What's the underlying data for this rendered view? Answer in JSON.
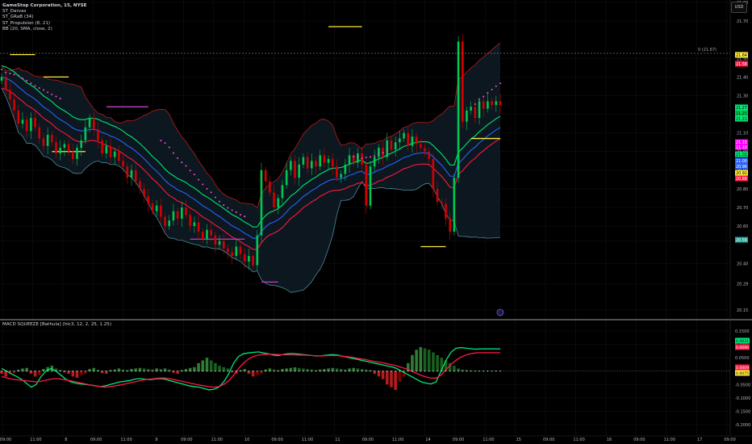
{
  "header": {
    "symbol": "GameStop Corporation, 15, NYSE",
    "indicators": [
      "ST_Darvas",
      "ST_GRaB (34)",
      "ST_Propulsion (8, 21)",
      "BB (20, SMA, close, 2)"
    ]
  },
  "currency_label": "USD",
  "lower_indicator_title": "MACD SQUEEZE [Bathula] (hlc3, 12, 2, 25, 1.25)",
  "price_axis": {
    "ticks": [
      "21.80",
      "21.70",
      "21.50",
      "21.40",
      "21.30",
      "21.20",
      "21.10",
      "21.00",
      "20.90",
      "20.80",
      "20.70",
      "20.60",
      "20.52",
      "20.40",
      "20.29",
      "20.15"
    ]
  },
  "price_level_label": "0 (21.67)",
  "price_badges": [
    {
      "text": "21.64",
      "color": "#ffeb3b",
      "textColor": "#000"
    },
    {
      "text": "21.58",
      "color": "#ff1744",
      "textColor": "#fff"
    },
    {
      "text": "21.27",
      "color": "#00e676",
      "textColor": "#000"
    },
    {
      "text": "21.25",
      "color": "#00c853",
      "textColor": "#000"
    },
    {
      "text": "21.21",
      "color": "#00e676",
      "textColor": "#000"
    },
    {
      "text": "21.15",
      "color": "#ff00ff",
      "textColor": "#fff"
    },
    {
      "text": "21.10",
      "color": "#ff00ff",
      "textColor": "#fff"
    },
    {
      "text": "21.02",
      "color": "#00e676",
      "textColor": "#000"
    },
    {
      "text": "21.00",
      "color": "#2962ff",
      "textColor": "#fff"
    },
    {
      "text": "20.96",
      "color": "#2962ff",
      "textColor": "#fff"
    },
    {
      "text": "20.92",
      "color": "#ffeb3b",
      "textColor": "#000"
    },
    {
      "text": "20.88",
      "color": "#ff1744",
      "textColor": "#fff"
    },
    {
      "text": "20.56",
      "color": "#26a69a",
      "textColor": "#fff"
    }
  ],
  "macd_axis": {
    "ticks": [
      "0.1500",
      "0.1000",
      "0.0500",
      "0.0000",
      "-0.0500",
      "-0.1000",
      "-0.1500",
      "-0.2000"
    ]
  },
  "macd_badges": [
    {
      "text": "0.0831",
      "color": "#00e676",
      "textColor": "#000"
    },
    {
      "text": "0.0690",
      "color": "#ff1744",
      "textColor": "#fff"
    },
    {
      "text": "0.0009",
      "color": "#ff1744",
      "textColor": "#fff"
    },
    {
      "text": "0.0075",
      "color": "#ffeb3b",
      "textColor": "#000"
    }
  ],
  "time_axis": {
    "labels": [
      "09:00",
      "11:00",
      "8",
      "09:00",
      "11:00",
      "9",
      "09:00",
      "11:00",
      "10",
      "09:00",
      "11:00",
      "11",
      "09:00",
      "11:00",
      "14",
      "09:00",
      "11:00",
      "15",
      "09:00",
      "11:00",
      "16",
      "09:00",
      "11:00",
      "17",
      "09:00"
    ]
  },
  "colors": {
    "background": "#000000",
    "up": "#00c853",
    "down": "#d50000",
    "bb_band": "#b71c1c",
    "bb_lower": "#4a8a9a",
    "grab_green": "#00e676",
    "grab_blue": "#2962ff",
    "grab_red": "#ff1744",
    "darvas_box": "#ffeb3b",
    "dots": "#ff4fd8"
  },
  "chart_data": [
    {
      "type": "candlestick",
      "title": "GameStop Corporation, 15, NYSE",
      "xlabel": "",
      "ylabel": "USD",
      "ylim": [
        20.15,
        21.8
      ],
      "grid": true,
      "last_close": 21.27,
      "close": [
        21.4,
        21.33,
        21.28,
        21.22,
        21.15,
        21.17,
        21.11,
        21.18,
        21.13,
        21.07,
        21.03,
        21.09,
        21.05,
        20.99,
        21.02,
        21.04,
        21.0,
        20.96,
        21.02,
        21.06,
        21.13,
        21.18,
        21.12,
        21.06,
        20.99,
        21.03,
        20.97,
        21.0,
        20.95,
        20.92,
        20.86,
        20.9,
        20.84,
        20.8,
        20.76,
        20.72,
        20.68,
        20.71,
        20.65,
        20.6,
        20.63,
        20.68,
        20.64,
        20.7,
        20.66,
        20.6,
        20.62,
        20.57,
        20.53,
        20.58,
        20.55,
        20.5,
        20.52,
        20.48,
        20.46,
        20.44,
        20.49,
        20.45,
        20.41,
        20.44,
        20.39,
        20.55,
        20.9,
        20.84,
        20.78,
        20.7,
        20.75,
        20.82,
        20.9,
        20.95,
        20.86,
        20.93,
        20.97,
        20.91,
        20.95,
        20.92,
        20.98,
        20.94,
        20.96,
        20.92,
        20.86,
        20.88,
        20.93,
        20.98,
        20.94,
        20.99,
        20.93,
        20.71,
        20.92,
        20.97,
        21.02,
        20.97,
        21.06,
        21.01,
        21.05,
        21.07,
        21.1,
        21.03,
        21.08,
        21.04,
        21.02,
        21.0,
        20.96,
        20.8,
        20.73,
        20.72,
        20.64,
        20.57,
        20.86,
        21.59,
        21.16,
        21.22,
        21.24,
        21.18,
        21.27,
        21.23,
        21.27,
        21.25,
        21.27,
        21.25
      ],
      "darvas_levels": [
        21.52,
        21.0,
        21.4,
        21.24,
        20.53,
        20.3,
        21.67,
        20.49,
        21.07
      ],
      "bollinger": {
        "period": 20,
        "stddev": 2,
        "type": "SMA",
        "source": "close"
      },
      "grab_ema": 34,
      "propulsion": [
        8,
        21
      ]
    },
    {
      "type": "bar",
      "title": "MACD SQUEEZE [Bathula] (hlc3, 12, 2, 25, 1.25)",
      "xlabel": "",
      "ylabel": "",
      "ylim": [
        -0.2,
        0.15
      ],
      "grid": true,
      "series": [
        {
          "name": "MACD",
          "style": "histogram"
        },
        {
          "name": "",
          "style": "line",
          "color": "#00e676"
        },
        {
          "name": "",
          "style": "line",
          "color": "#ff1744"
        }
      ],
      "last_values": [
        0.0831,
        0.069,
        0.0009,
        0.0075
      ],
      "hist": [
        -0.01,
        -0.02,
        -0.012,
        -0.008,
        0.005,
        0.01,
        0.012,
        -0.01,
        -0.02,
        -0.015,
        0.008,
        0.015,
        0.02,
        0.01,
        0.005,
        -0.005,
        -0.01,
        -0.02,
        -0.025,
        -0.015,
        -0.01,
        0.008,
        0.012,
        0.005,
        -0.008,
        -0.01,
        0.004,
        0.006,
        0.01,
        0.006,
        0.004,
        0.008,
        0.01,
        0.012,
        0.01,
        0.008,
        0.006,
        0.01,
        0.008,
        0.01,
        0.006,
        -0.006,
        -0.01,
        0.004,
        0.008,
        0.012,
        0.015,
        0.03,
        0.04,
        0.05,
        0.04,
        0.03,
        0.02,
        0.015,
        0.01,
        -0.005,
        -0.01,
        0.004,
        0.008,
        -0.01,
        -0.02,
        -0.015,
        -0.01,
        0.006,
        0.01,
        0.006,
        0.004,
        0.008,
        0.01,
        0.012,
        0.014,
        0.012,
        0.01,
        0.008,
        0.006,
        0.004,
        0.006,
        0.008,
        0.01,
        0.012,
        0.01,
        0.008,
        0.006,
        0.01,
        0.012,
        0.01,
        0.008,
        0.006,
        0.004,
        -0.01,
        -0.02,
        -0.03,
        -0.05,
        -0.06,
        -0.07,
        -0.04,
        -0.02,
        0.03,
        0.06,
        0.08,
        0.09,
        0.085,
        0.08,
        0.07,
        0.06,
        0.05,
        0.04,
        0.03,
        0.02,
        0.01,
        0.006,
        0.004,
        0.003,
        0.002,
        0.001,
        0.001,
        0.001,
        0.001,
        0.001,
        0.001
      ],
      "fast": [
        0.01,
        0.0,
        -0.01,
        -0.02,
        -0.03,
        -0.045,
        -0.06,
        -0.05,
        -0.02,
        0.0,
        0.01,
        0.0,
        -0.015,
        -0.03,
        -0.04,
        -0.045,
        -0.048,
        -0.05,
        -0.052,
        -0.055,
        -0.058,
        -0.055,
        -0.05,
        -0.045,
        -0.04,
        -0.038,
        -0.035,
        -0.03,
        -0.028,
        -0.03,
        -0.032,
        -0.03,
        -0.028,
        -0.03,
        -0.035,
        -0.04,
        -0.045,
        -0.05,
        -0.055,
        -0.058,
        -0.06,
        -0.065,
        -0.07,
        -0.068,
        -0.06,
        -0.04,
        -0.01,
        0.03,
        0.055,
        0.065,
        0.068,
        0.07,
        0.072,
        0.068,
        0.065,
        0.06,
        0.058,
        0.062,
        0.065,
        0.066,
        0.064,
        0.062,
        0.06,
        0.058,
        0.056,
        0.058,
        0.06,
        0.062,
        0.06,
        0.056,
        0.052,
        0.048,
        0.044,
        0.04,
        0.036,
        0.032,
        0.028,
        0.024,
        0.02,
        0.016,
        0.01,
        0.0,
        -0.01,
        -0.02,
        -0.03,
        -0.04,
        -0.045,
        -0.048,
        -0.04,
        0.0,
        0.04,
        0.07,
        0.085,
        0.088,
        0.086,
        0.084,
        0.082,
        0.083,
        0.083,
        0.083,
        0.083,
        0.083
      ],
      "slow": [
        -0.02,
        -0.025,
        -0.03,
        -0.032,
        -0.034,
        -0.036,
        -0.038,
        -0.04,
        -0.038,
        -0.034,
        -0.03,
        -0.028,
        -0.03,
        -0.033,
        -0.036,
        -0.04,
        -0.044,
        -0.048,
        -0.052,
        -0.055,
        -0.058,
        -0.06,
        -0.058,
        -0.055,
        -0.052,
        -0.048,
        -0.044,
        -0.04,
        -0.036,
        -0.032,
        -0.03,
        -0.028,
        -0.026,
        -0.026,
        -0.028,
        -0.032,
        -0.036,
        -0.04,
        -0.044,
        -0.048,
        -0.052,
        -0.055,
        -0.058,
        -0.06,
        -0.058,
        -0.05,
        -0.036,
        -0.015,
        0.01,
        0.03,
        0.045,
        0.055,
        0.06,
        0.062,
        0.063,
        0.063,
        0.062,
        0.061,
        0.061,
        0.061,
        0.06,
        0.06,
        0.059,
        0.058,
        0.057,
        0.057,
        0.058,
        0.058,
        0.058,
        0.056,
        0.054,
        0.052,
        0.048,
        0.045,
        0.042,
        0.038,
        0.035,
        0.032,
        0.028,
        0.024,
        0.02,
        0.014,
        0.008,
        0.0,
        -0.008,
        -0.016,
        -0.022,
        -0.026,
        -0.026,
        -0.015,
        0.005,
        0.025,
        0.04,
        0.052,
        0.06,
        0.065,
        0.068,
        0.069,
        0.069,
        0.069,
        0.069,
        0.069
      ]
    }
  ]
}
